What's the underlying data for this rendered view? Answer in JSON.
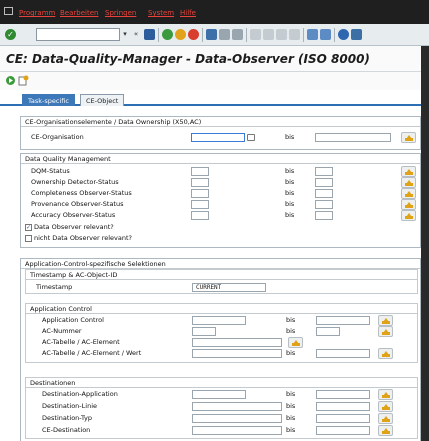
{
  "menu": {
    "items": [
      "Programm",
      "Bearbeiten",
      "Springen",
      "System",
      "Hilfe"
    ]
  },
  "toolbar": {
    "command_value": "",
    "icons": [
      "ok-icon",
      "save-icon",
      "back-icon",
      "exit-icon",
      "cancel-icon",
      "print-icon",
      "find-icon",
      "find-next-icon",
      "first-page-icon",
      "prev-page-icon",
      "next-page-icon",
      "last-page-icon",
      "new-session-icon",
      "shortcut-icon",
      "help-icon",
      "layout-icon"
    ]
  },
  "title": "CE: Data-Quality-Manager - Data-Observer (ISO 8000)",
  "tabs": [
    "Task-specific",
    "CE-Object"
  ],
  "bis": "bis",
  "section_org": {
    "header": "CE-Organisationselemente / Data Ownership (X50,AC)",
    "rows": [
      {
        "label": "CE-Organisation",
        "from": "",
        "to": ""
      }
    ]
  },
  "section_dq": {
    "header": "Data Quality Management",
    "rows": [
      {
        "label": "DQM-Status",
        "from": "",
        "to": ""
      },
      {
        "label": "Ownership Detector-Status",
        "from": "",
        "to": ""
      },
      {
        "label": "Completeness Observer-Status",
        "from": "",
        "to": ""
      },
      {
        "label": "Provenance Observer-Status",
        "from": "",
        "to": ""
      },
      {
        "label": "Accuracy Observer-Status",
        "from": "",
        "to": ""
      }
    ],
    "checkboxes": [
      {
        "label": "Data Observer relevant?",
        "checked": true
      },
      {
        "label": "nicht Data Observer relevant?",
        "checked": false
      }
    ]
  },
  "section_ac": {
    "header": "Application-Control-spezifische Selektionen",
    "timestamp_group": {
      "header": "Timestamp & AC-Object-ID",
      "label": "Timestamp",
      "value": "CURRENT"
    },
    "control_group": {
      "header": "Application Control",
      "rows": [
        {
          "label": "Application Control",
          "from": "",
          "to": ""
        },
        {
          "label": "AC-Nummer",
          "from": "",
          "to": ""
        },
        {
          "label": "AC-Tabelle / AC-Element",
          "from": ""
        },
        {
          "label": "AC-Tabelle / AC-Element / Wert",
          "from": "",
          "to": ""
        }
      ]
    },
    "dest_group": {
      "header": "Destinationen",
      "rows": [
        {
          "label": "Destination-Application",
          "from": "",
          "to": ""
        },
        {
          "label": "Destination-Linie",
          "from": "",
          "to": ""
        },
        {
          "label": "Destination-Typ",
          "from": "",
          "to": ""
        },
        {
          "label": "CE-Destination",
          "from": "",
          "to": ""
        }
      ]
    }
  }
}
